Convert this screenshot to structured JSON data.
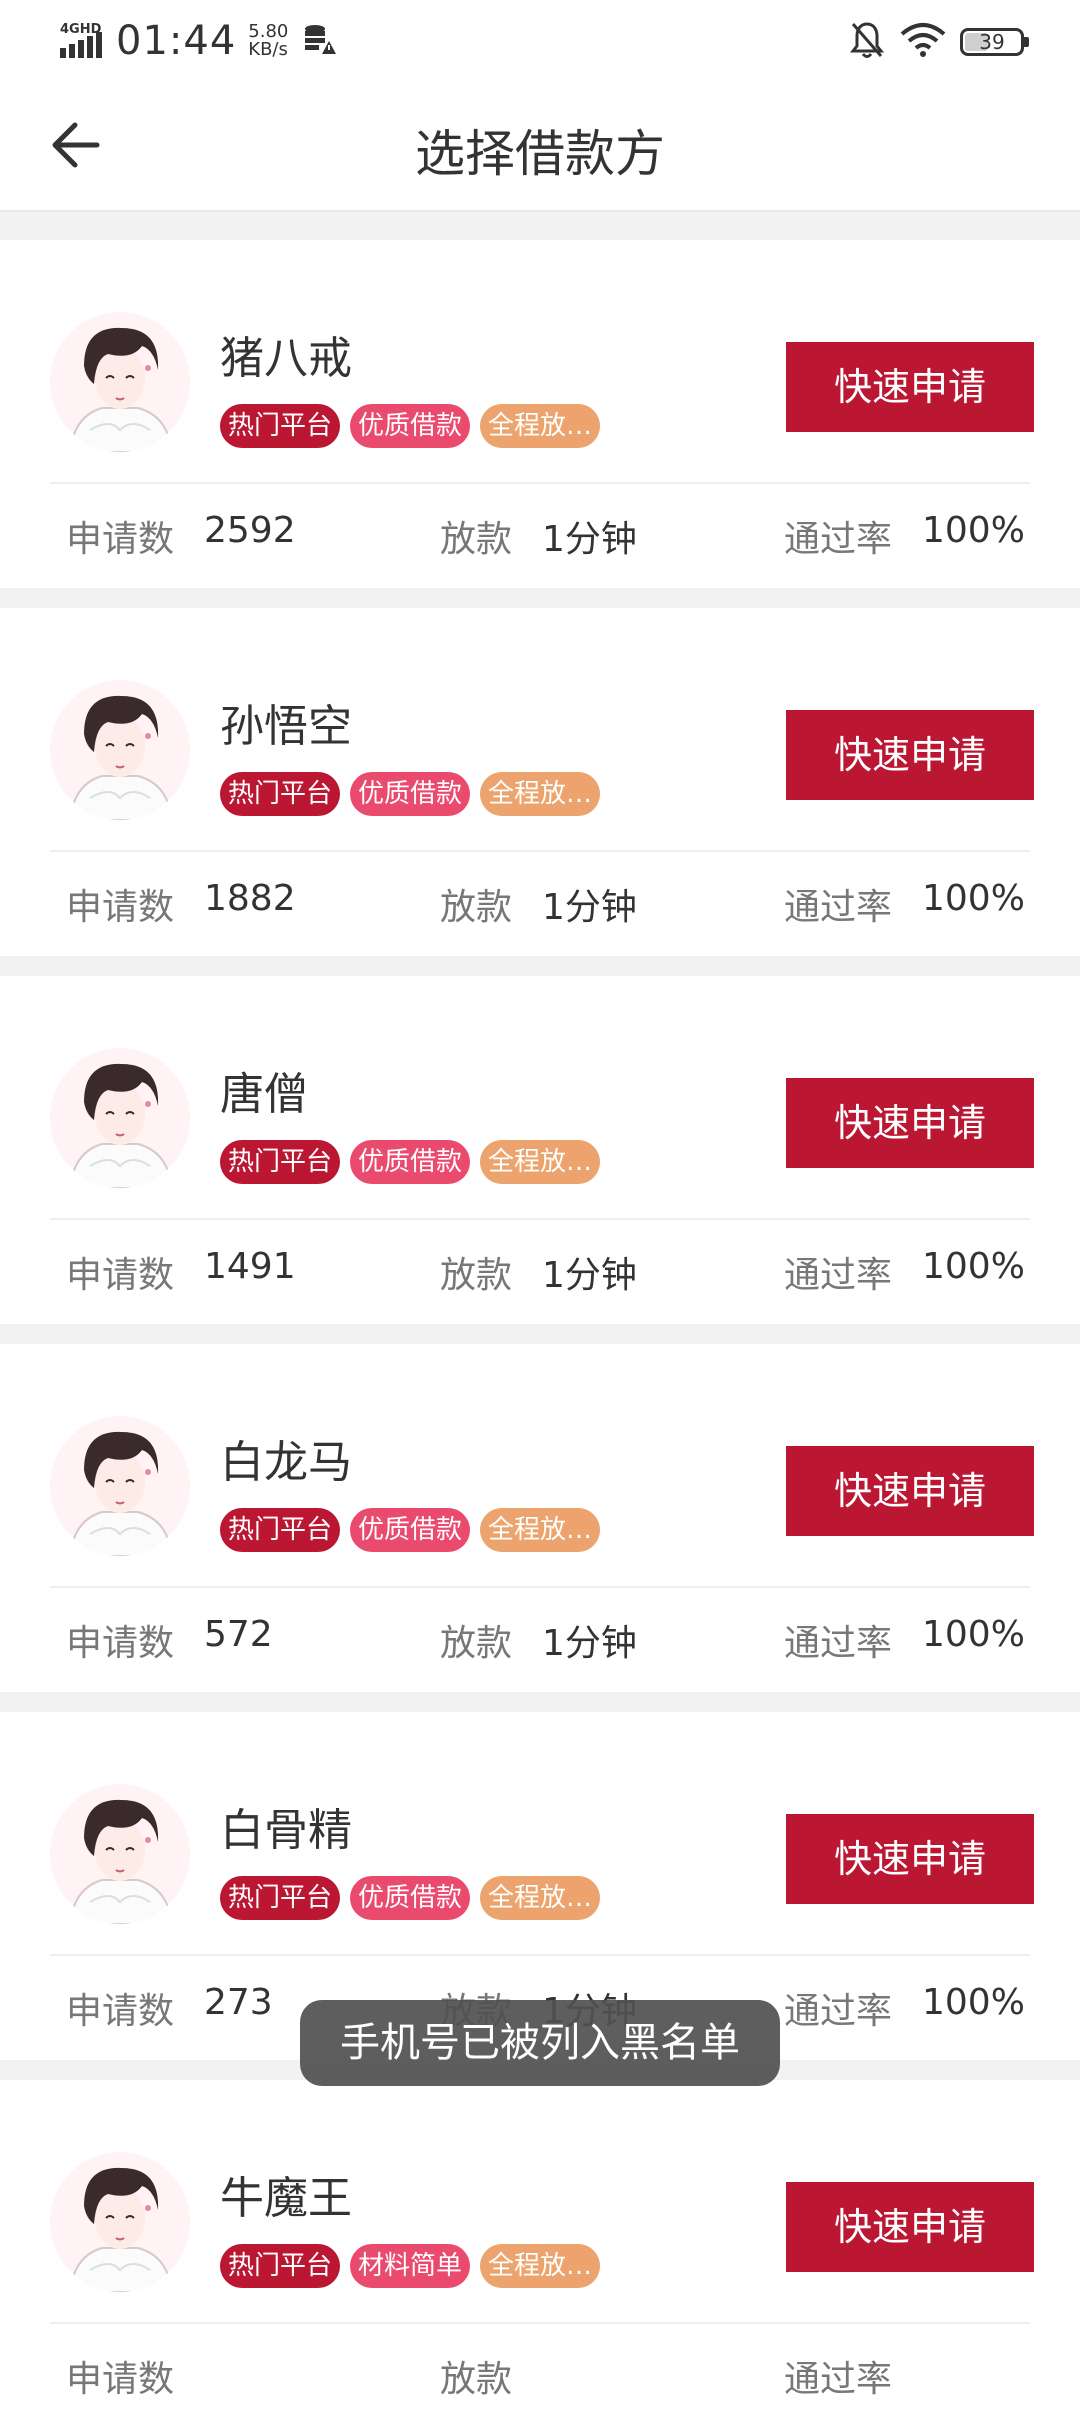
{
  "status_bar": {
    "network": "4GHD",
    "time": "01:44",
    "speed_value": "5.80",
    "speed_unit": "KB/s",
    "battery": "39"
  },
  "header": {
    "title": "选择借款方",
    "back_icon": "arrow-left-icon"
  },
  "colors": {
    "primary": "#bb1733",
    "tag_hot": "#bb1733",
    "tag_quality": "#ea4a6e",
    "tag_full": "#eca36d"
  },
  "labels": {
    "apply_count": "申请数",
    "loan": "放款",
    "pass_rate": "通过率",
    "apply_button": "快速申请"
  },
  "lenders": [
    {
      "name": "猪八戒",
      "tags": [
        "热门平台",
        "优质借款",
        "全程放…"
      ],
      "apply_count": "2592",
      "loan_time": "1分钟",
      "pass_rate": "100%"
    },
    {
      "name": "孙悟空",
      "tags": [
        "热门平台",
        "优质借款",
        "全程放…"
      ],
      "apply_count": "1882",
      "loan_time": "1分钟",
      "pass_rate": "100%"
    },
    {
      "name": "唐僧",
      "tags": [
        "热门平台",
        "优质借款",
        "全程放…"
      ],
      "apply_count": "1491",
      "loan_time": "1分钟",
      "pass_rate": "100%"
    },
    {
      "name": "白龙马",
      "tags": [
        "热门平台",
        "优质借款",
        "全程放…"
      ],
      "apply_count": "572",
      "loan_time": "1分钟",
      "pass_rate": "100%"
    },
    {
      "name": "白骨精",
      "tags": [
        "热门平台",
        "优质借款",
        "全程放…"
      ],
      "apply_count": "273",
      "loan_time": "1分钟",
      "pass_rate": "100%"
    },
    {
      "name": "牛魔王",
      "tags": [
        "热门平台",
        "材料简单",
        "全程放…"
      ],
      "apply_count": "",
      "loan_time": "",
      "pass_rate": ""
    }
  ],
  "toast": "手机号已被列入黑名单"
}
